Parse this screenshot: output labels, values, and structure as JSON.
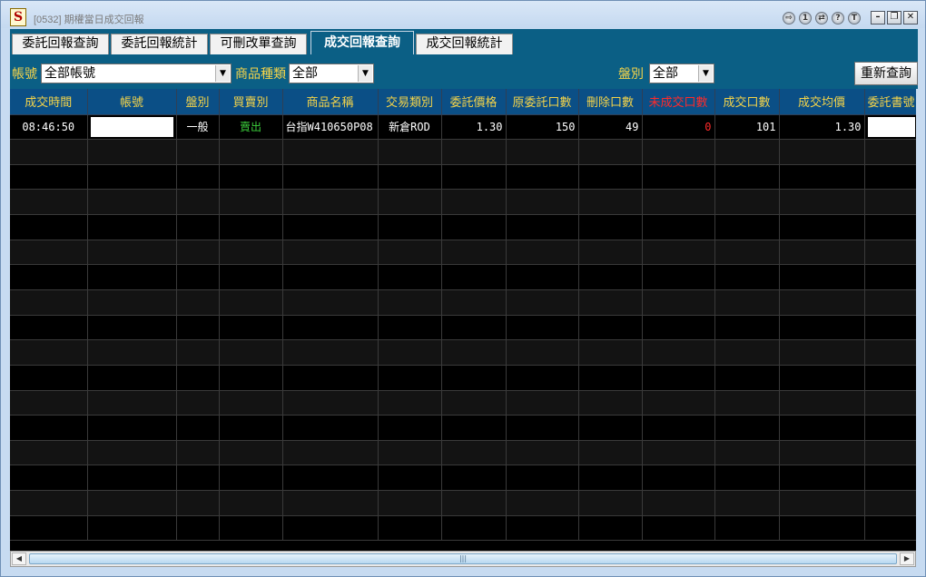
{
  "window": {
    "title": "[0532] 期權當日成交回報",
    "logo": "S",
    "controls": [
      "⇨",
      "1",
      "⇄",
      "?",
      "T"
    ]
  },
  "tabs": [
    {
      "label": "委託回報查詢",
      "active": false
    },
    {
      "label": "委託回報統計",
      "active": false
    },
    {
      "label": "可刪改單查詢",
      "active": false
    },
    {
      "label": "成交回報查詢",
      "active": true
    },
    {
      "label": "成交回報統計",
      "active": false
    }
  ],
  "filters": {
    "account_label": "帳號",
    "account_value": "全部帳號",
    "product_type_label": "商品種類",
    "product_type_value": "全部",
    "session_label": "盤別",
    "session_value": "全部",
    "requery_label": "重新查詢"
  },
  "table": {
    "columns": [
      "成交時間",
      "帳號",
      "盤別",
      "買賣別",
      "商品名稱",
      "交易類別",
      "委託價格",
      "原委託口數",
      "刪除口數",
      "未成交口數",
      "成交口數",
      "成交均價",
      "委託書號"
    ],
    "rows": [
      {
        "time": "08:46:50",
        "account": "",
        "session": "一般",
        "side": "賣出",
        "product": "台指W410650P08",
        "trade_type": "新倉ROD",
        "order_price": "1.30",
        "orig_qty": "150",
        "cancel_qty": "49",
        "unfilled_qty": "0",
        "filled_qty": "101",
        "avg_price": "1.30",
        "order_no": ""
      }
    ]
  },
  "colors": {
    "panel": "#0b5f85",
    "header_bg": "#0b4f86",
    "header_text": "#f3d34a",
    "sell": "#3ccf3c",
    "alert": "#ff2a2a"
  }
}
